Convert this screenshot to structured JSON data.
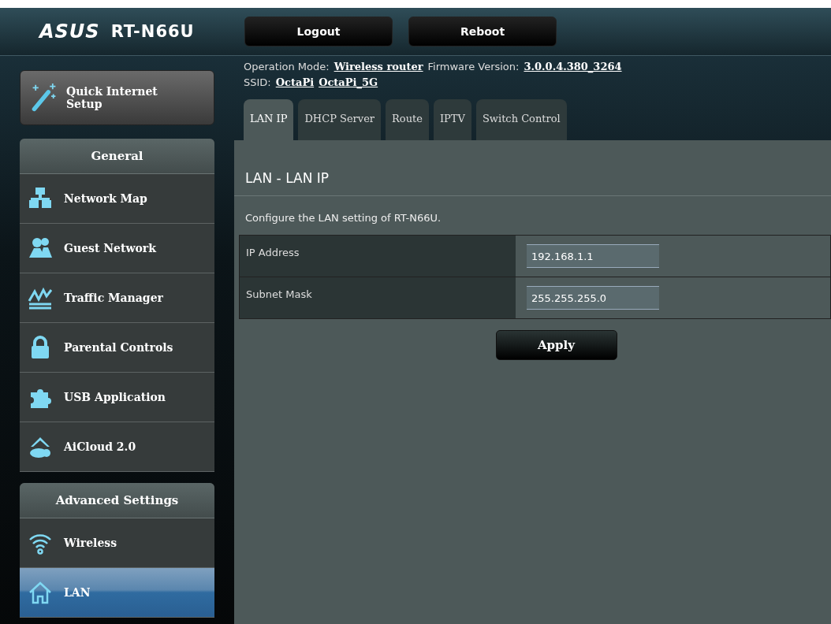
{
  "header": {
    "logo": "ASUS",
    "model": "RT-N66U",
    "buttons": [
      "Logout",
      "Reboot"
    ]
  },
  "quick_setup": {
    "label": "Quick Internet Setup"
  },
  "sidebar": [
    {
      "title": "General",
      "items": [
        {
          "label": "Network Map",
          "selected": false
        },
        {
          "label": "Guest Network",
          "selected": false
        },
        {
          "label": "Traffic Manager",
          "selected": false
        },
        {
          "label": "Parental Controls",
          "selected": false
        },
        {
          "label": "USB Application",
          "selected": false
        },
        {
          "label": "AiCloud 2.0",
          "selected": false
        }
      ]
    },
    {
      "title": "Advanced Settings",
      "items": [
        {
          "label": "Wireless",
          "selected": false
        },
        {
          "label": "LAN",
          "selected": true
        }
      ]
    }
  ],
  "info": {
    "operation_mode_label": "Operation Mode:",
    "operation_mode": "Wireless router",
    "firmware_label": "Firmware Version:",
    "firmware": "3.0.0.4.380_3264",
    "ssid_label": "SSID:",
    "ssids": [
      "OctaPi",
      "OctaPi_5G"
    ]
  },
  "tabs": [
    {
      "label": "LAN IP",
      "selected": true
    },
    {
      "label": "DHCP Server",
      "selected": false
    },
    {
      "label": "Route",
      "selected": false
    },
    {
      "label": "IPTV",
      "selected": false
    },
    {
      "label": "Switch Control",
      "selected": false
    }
  ],
  "page": {
    "title": "LAN - LAN IP",
    "description": "Configure the LAN setting of RT-N66U.",
    "fields": [
      {
        "label": "IP Address",
        "value": "192.168.1.1"
      },
      {
        "label": "Subnet Mask",
        "value": "255.255.255.0"
      }
    ],
    "apply": "Apply"
  }
}
